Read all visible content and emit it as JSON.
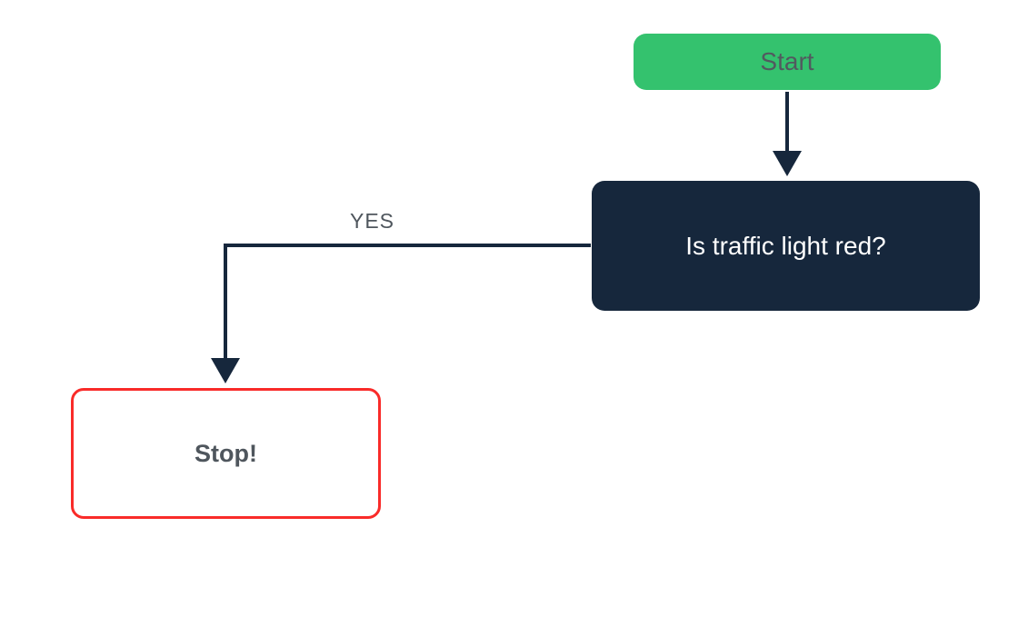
{
  "nodes": {
    "start": {
      "label": "Start"
    },
    "decision": {
      "label": "Is traffic light red?"
    },
    "stop": {
      "label": "Stop!"
    }
  },
  "edges": {
    "yes_label": "YES"
  },
  "colors": {
    "start_bg": "#34C26E",
    "decision_bg": "#16273C",
    "stop_border": "#F92B29",
    "arrow": "#16273C",
    "text_muted": "#4F565D"
  }
}
